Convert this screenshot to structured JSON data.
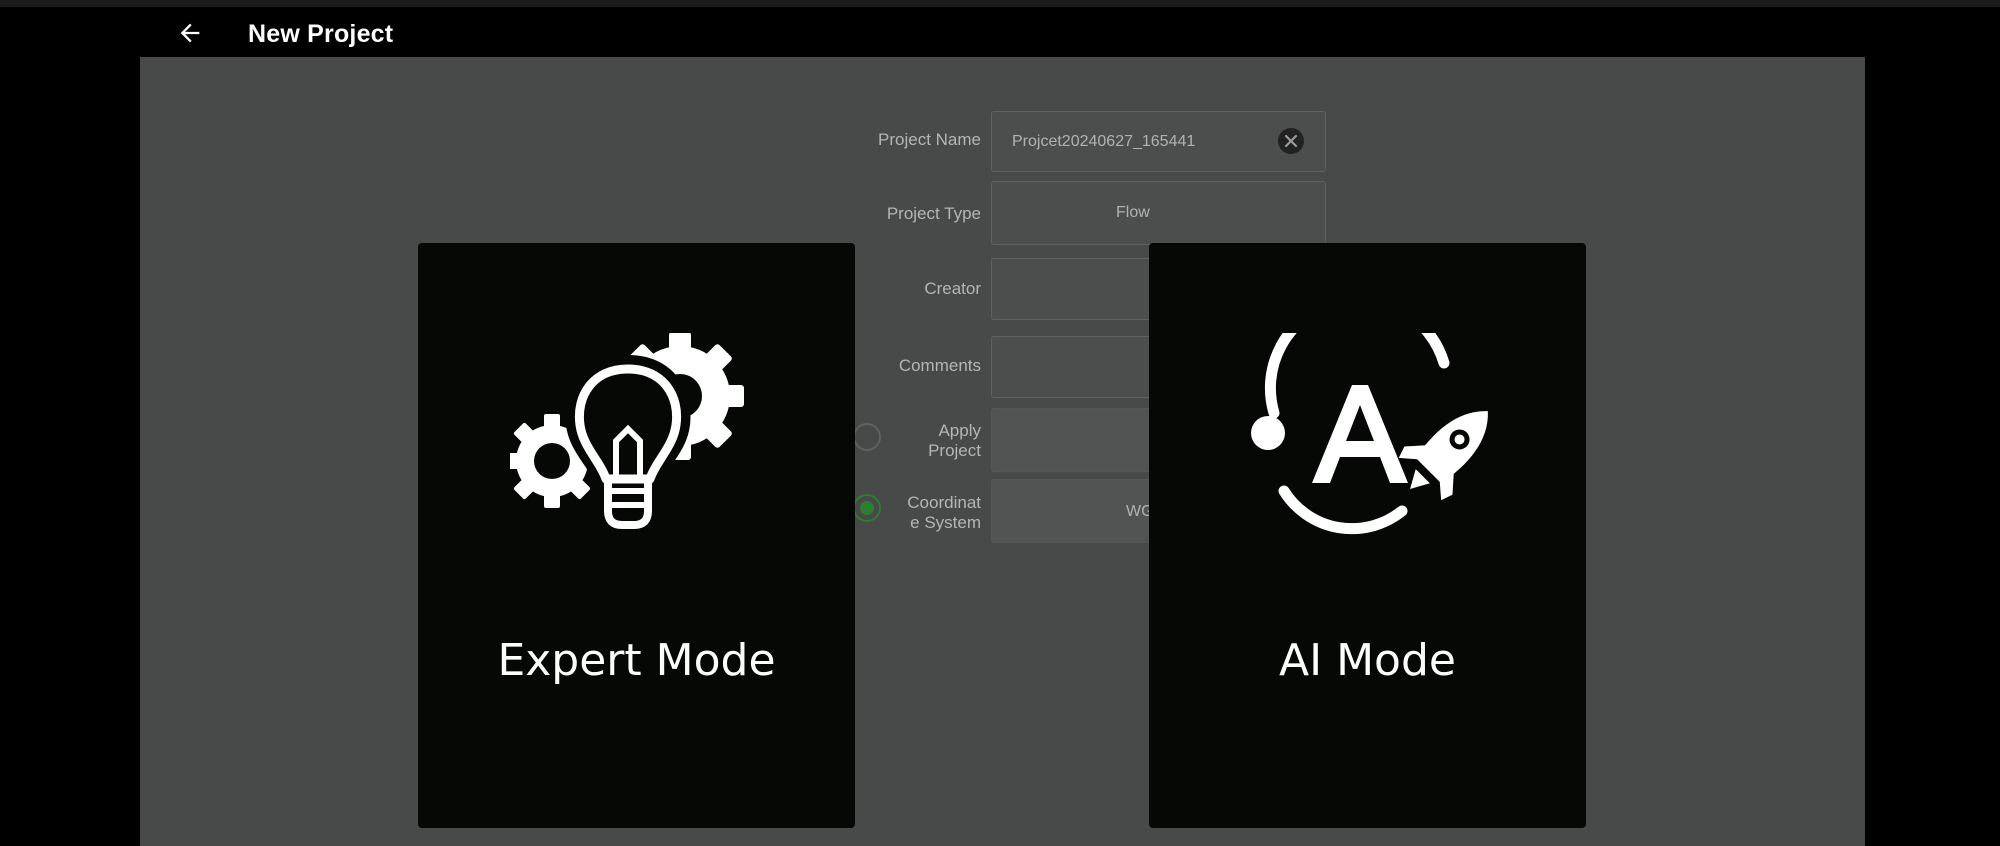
{
  "appbar": {
    "back_icon": "arrow-left-icon",
    "title": "New Project"
  },
  "form": {
    "project_name": {
      "label": "Project Name",
      "value": "Projcet20240627_165441",
      "clear_icon": "close-circle-icon"
    },
    "project_type": {
      "label": "Project Type",
      "value": "Flow"
    },
    "creator": {
      "label": "Creator",
      "value": ""
    },
    "comments": {
      "label": "Comments",
      "value": ""
    },
    "apply_project": {
      "label_line1": "Apply",
      "label_line2": "Project",
      "selected": false
    },
    "coordinate_system": {
      "label_line1": "Coordinat",
      "label_line2": "e System",
      "value": "WG",
      "selected": true
    }
  },
  "modes": {
    "expert": {
      "label": "Expert Mode",
      "icon": "lightbulb-gears-icon"
    },
    "ai": {
      "label": "AI Mode",
      "icon": "ai-rocket-icon"
    }
  },
  "colors": {
    "overlay_bg": "#474a48",
    "card_bg": "#050805",
    "radio_selected": "#2e7d32"
  }
}
